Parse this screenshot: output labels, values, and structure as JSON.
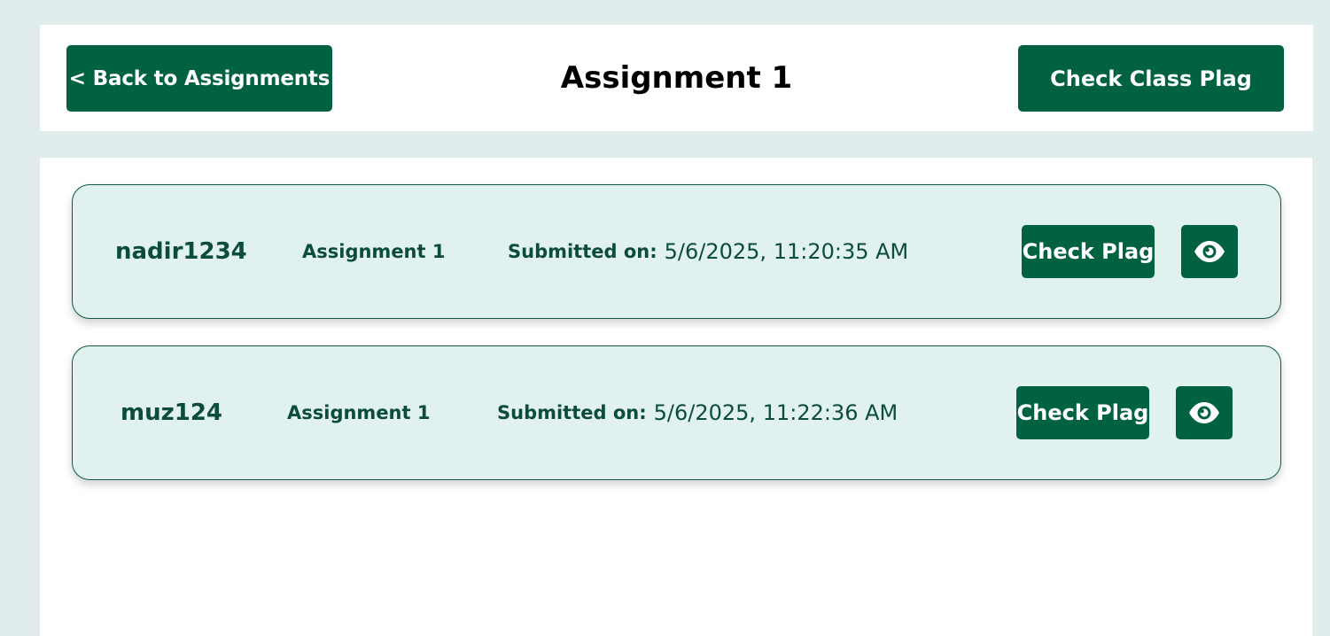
{
  "header": {
    "back_label": "< Back to Assignments",
    "title": "Assignment 1",
    "class_plag_label": "Check Class Plag"
  },
  "submissions": [
    {
      "username": "nadir1234",
      "assignment": "Assignment 1",
      "submitted_label": "Submitted on:",
      "submitted_value": "5/6/2025, 11:20:35 AM",
      "check_label": "Check Plag",
      "view_icon": "eye-icon"
    },
    {
      "username": "muz124",
      "assignment": "Assignment 1",
      "submitted_label": "Submitted on:",
      "submitted_value": "5/6/2025, 11:22:36 AM",
      "check_label": "Check Plag",
      "view_icon": "eye-icon"
    }
  ],
  "colors": {
    "primary": "#016241",
    "card_bg": "#e0f1f0",
    "card_text": "#0b4c3d",
    "page_bg": "#e1ecec"
  }
}
